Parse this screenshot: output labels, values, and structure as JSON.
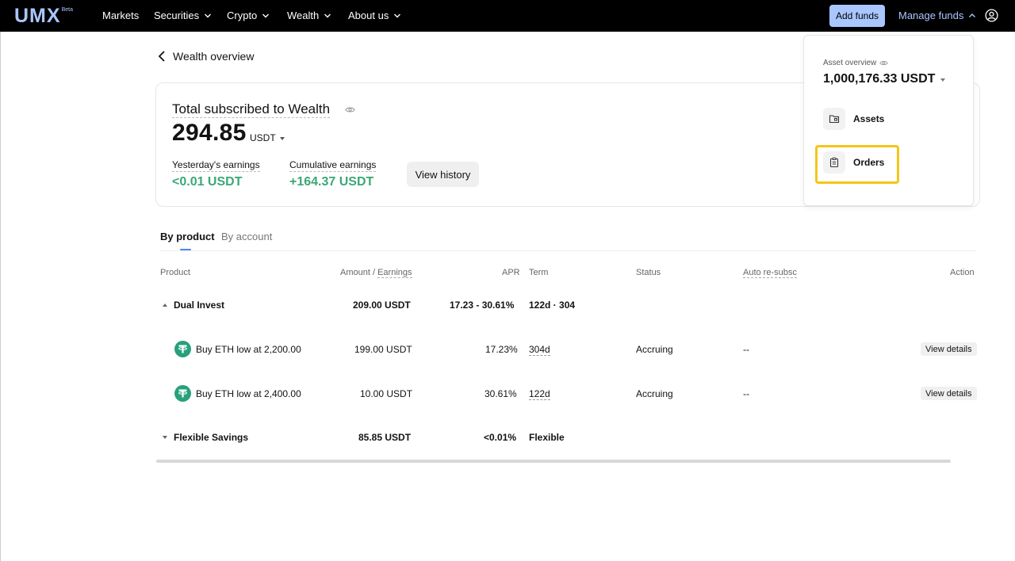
{
  "nav": {
    "logo_text": "UMX",
    "logo_badge": "Beta",
    "items": [
      {
        "label": "Markets",
        "has_dropdown": false
      },
      {
        "label": "Securities",
        "has_dropdown": true
      },
      {
        "label": "Crypto",
        "has_dropdown": true
      },
      {
        "label": "Wealth",
        "has_dropdown": true
      },
      {
        "label": "About us",
        "has_dropdown": true
      }
    ],
    "add_funds_label": "Add funds",
    "manage_funds_label": "Manage funds",
    "accent_color": "#a9c6ff"
  },
  "header": {
    "back_icon": "chevron-left-icon",
    "title": "Wealth overview"
  },
  "summary": {
    "title": "Total subscribed to Wealth",
    "amount": "294.85",
    "currency": "USDT",
    "yesterday_label": "Yesterday's earnings",
    "yesterday_value": "<0.01 USDT",
    "cumulative_label": "Cumulative earnings",
    "cumulative_value": "+164.37 USDT",
    "view_history_label": "View history",
    "positive_color": "#3aa876"
  },
  "tabs": [
    {
      "label": "By product",
      "active": true
    },
    {
      "label": "By account",
      "active": false
    }
  ],
  "table": {
    "headers": {
      "product": "Product",
      "amount": "Amount",
      "amount_sep": " / ",
      "earnings": "Earnings",
      "apr": "APR",
      "term": "Term",
      "status": "Status",
      "auto": "Auto re-subsc",
      "action": "Action"
    },
    "groups": [
      {
        "name": "Dual Invest",
        "amount": "209.00 USDT",
        "apr": "17.23 - 30.61%",
        "term": "122d · 304",
        "expanded": true
      },
      {
        "name": "Flexible Savings",
        "amount": "85.85 USDT",
        "apr": "<0.01%",
        "term": "Flexible",
        "expanded": false
      }
    ],
    "rows": [
      {
        "name": "Buy ETH low at 2,200.00",
        "amount": "199.00 USDT",
        "apr": "17.23%",
        "term": "304d",
        "status": "Accruing",
        "auto": "--",
        "action": "View details"
      },
      {
        "name": "Buy ETH low at 2,400.00",
        "amount": "10.00 USDT",
        "apr": "30.61%",
        "term": "122d",
        "status": "Accruing",
        "auto": "--",
        "action": "View details"
      }
    ]
  },
  "dropdown": {
    "label": "Asset overview",
    "amount": "1,000,176.33 USDT",
    "items": [
      {
        "label": "Assets",
        "icon": "folder-icon"
      },
      {
        "label": "Orders",
        "icon": "clipboard-icon"
      }
    ],
    "highlight_color": "#f5c518"
  }
}
